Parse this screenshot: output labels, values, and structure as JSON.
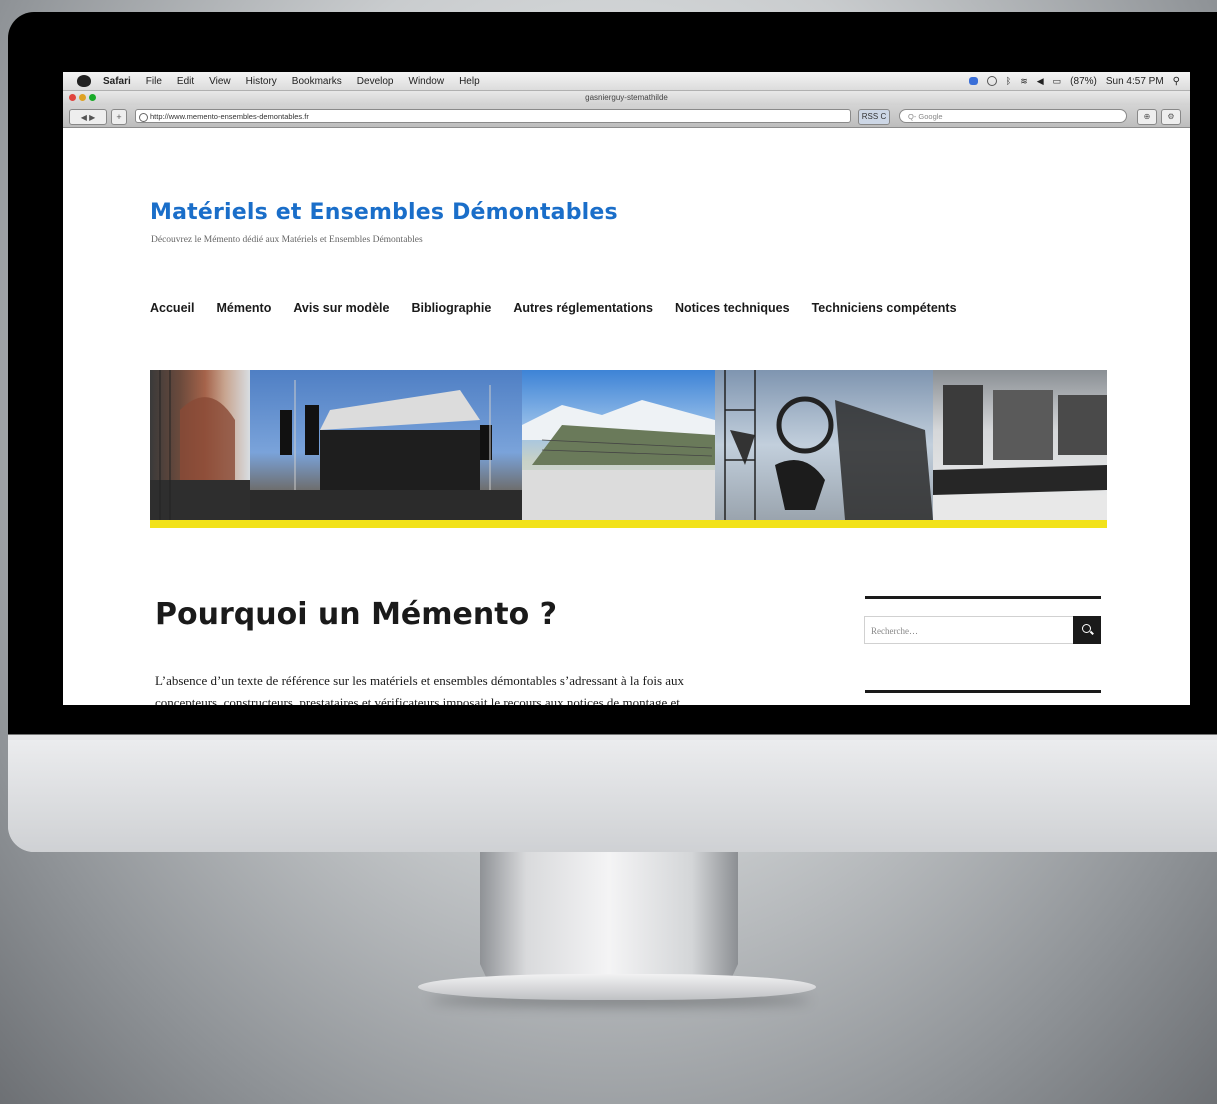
{
  "menubar": {
    "app": "Safari",
    "items": [
      "File",
      "Edit",
      "View",
      "History",
      "Bookmarks",
      "Develop",
      "Window",
      "Help"
    ],
    "battery": "(87%)",
    "clock": "Sun 4:57 PM"
  },
  "window": {
    "title": "gasnierguy-stemathilde"
  },
  "toolbar": {
    "back_forward": "◀ ▶",
    "add": "+",
    "url": "http://www.memento-ensembles-demontables.fr",
    "rss_reload": "RSS C",
    "search_placeholder": "Q- Google"
  },
  "site": {
    "title": "Matériels et Ensembles Démontables",
    "description": "Découvrez le Mémento dédié aux Matériels et Ensembles Démontables",
    "nav": [
      "Accueil",
      "Mémento",
      "Avis sur modèle",
      "Bibliographie",
      "Autres réglementations",
      "Notices techniques",
      "Techniciens compétents"
    ],
    "banner_color": "#f2e21a"
  },
  "post": {
    "title": "Pourquoi un Mémento ?",
    "body_line1": "L’absence d’un texte de référence sur les matériels et ensembles démontables s’adressant à la fois aux",
    "body_line2": "concepteurs, constructeurs, prestataires et vérificateurs imposait le recours aux notices de montage et"
  },
  "sidebar": {
    "search_placeholder": "Recherche…"
  },
  "colors": {
    "title_blue": "#1a6ec9",
    "text_dark": "#1a1a1a"
  }
}
